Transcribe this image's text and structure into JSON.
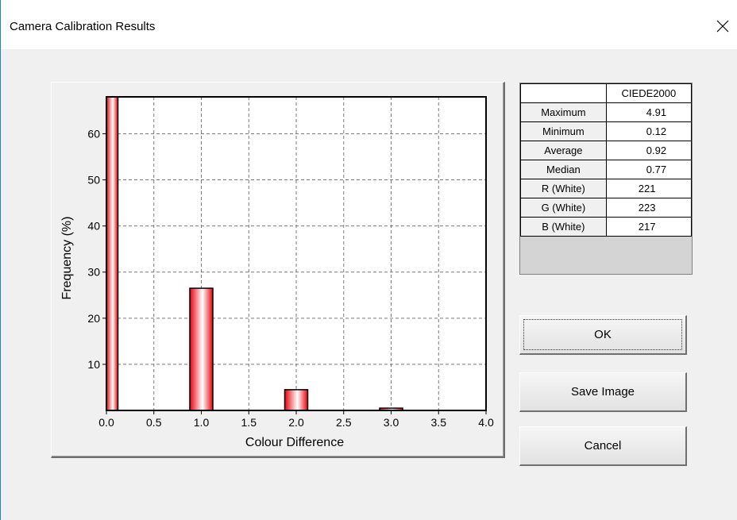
{
  "window": {
    "title": "Camera Calibration Results",
    "close_icon": "close-icon"
  },
  "chart_data": {
    "type": "bar",
    "xlabel": "Colour Difference",
    "ylabel": "Frequency (%)",
    "xlim": [
      0.0,
      4.0
    ],
    "ylim": [
      0,
      68
    ],
    "x_ticks": [
      "0.0",
      "0.5",
      "1.0",
      "1.5",
      "2.0",
      "2.5",
      "3.0",
      "3.5",
      "4.0"
    ],
    "y_ticks": [
      "10",
      "20",
      "30",
      "40",
      "50",
      "60"
    ],
    "bars": [
      {
        "x": 0.0,
        "value": 68
      },
      {
        "x": 1.0,
        "value": 26.5
      },
      {
        "x": 2.0,
        "value": 4.5
      },
      {
        "x": 3.0,
        "value": 0.5
      }
    ],
    "grid": true,
    "bar_color": "#e8000a"
  },
  "stats": {
    "column_header": "CIEDE2000",
    "rows": [
      {
        "label": "Maximum",
        "value": "4.91"
      },
      {
        "label": "Minimum",
        "value": "0.12"
      },
      {
        "label": "Average",
        "value": "0.92"
      },
      {
        "label": "Median",
        "value": "0.77"
      },
      {
        "label": "R (White)",
        "value": "221"
      },
      {
        "label": "G (White)",
        "value": "223"
      },
      {
        "label": "B (White)",
        "value": "217"
      }
    ]
  },
  "buttons": {
    "ok": "OK",
    "save": "Save Image",
    "cancel": "Cancel"
  }
}
